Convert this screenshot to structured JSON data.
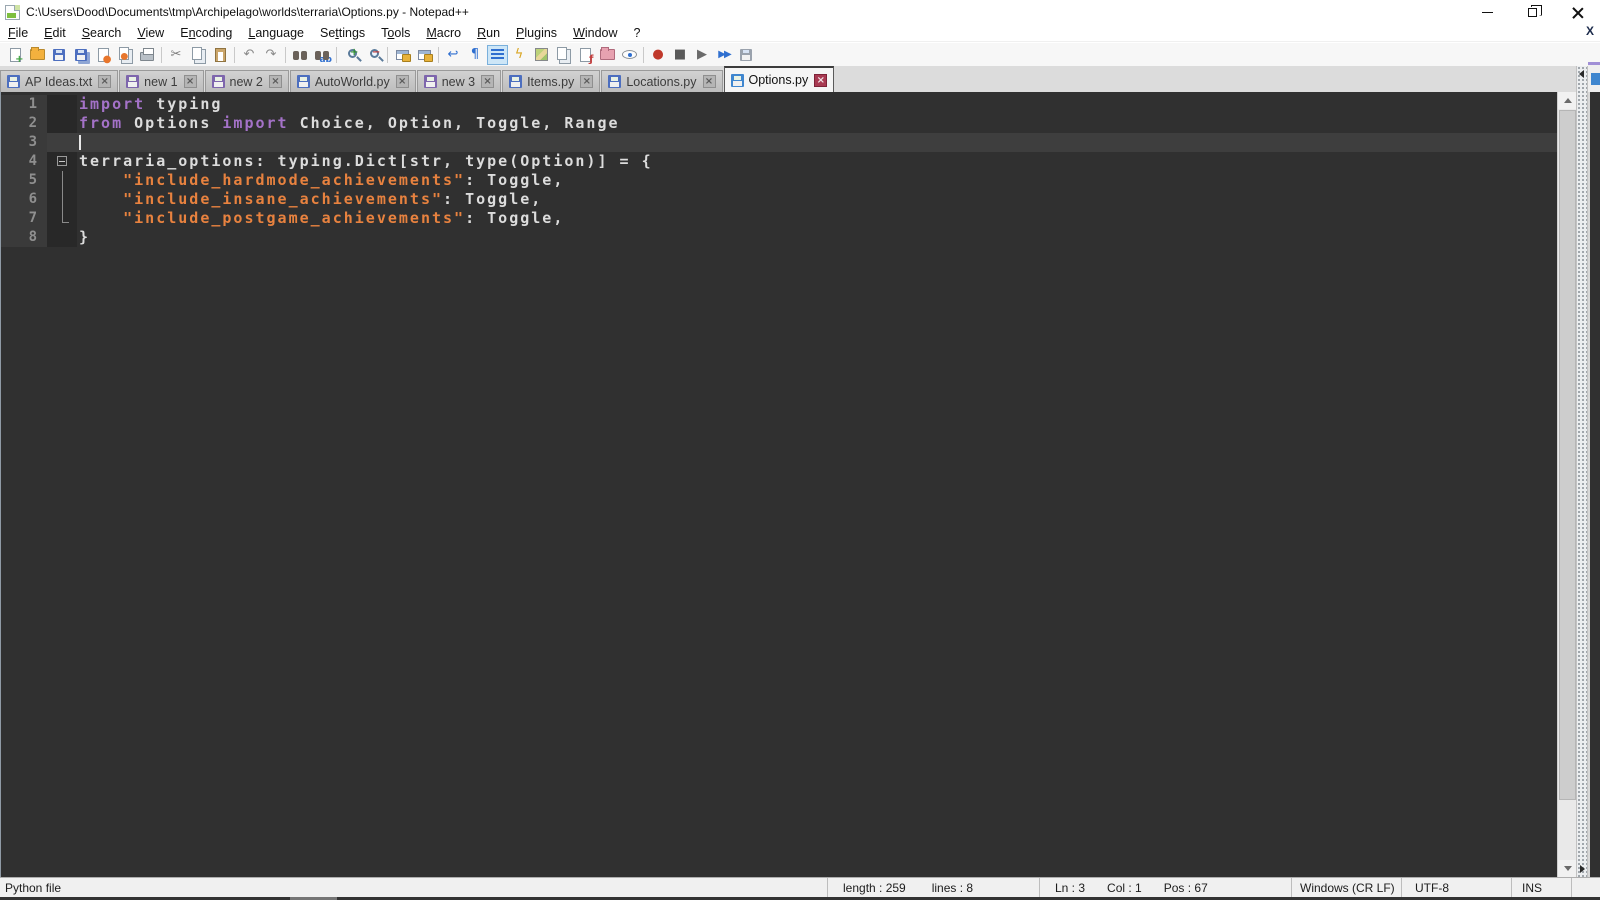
{
  "window": {
    "title": "C:\\Users\\Dood\\Documents\\tmp\\Archipelago\\worlds\\terraria\\Options.py - Notepad++",
    "menu_close_x": "X"
  },
  "menu": {
    "items": [
      {
        "label": "File",
        "u": 0
      },
      {
        "label": "Edit",
        "u": 0
      },
      {
        "label": "Search",
        "u": 0
      },
      {
        "label": "View",
        "u": 0
      },
      {
        "label": "Encoding",
        "u": 1
      },
      {
        "label": "Language",
        "u": 0
      },
      {
        "label": "Settings",
        "u": 2
      },
      {
        "label": "Tools",
        "u": 1
      },
      {
        "label": "Macro",
        "u": 0
      },
      {
        "label": "Run",
        "u": 0
      },
      {
        "label": "Plugins",
        "u": 0
      },
      {
        "label": "Window",
        "u": 0
      },
      {
        "label": "?",
        "u": -1
      }
    ]
  },
  "toolbar": {
    "items": [
      {
        "name": "new-file",
        "shape": "sh-page",
        "ov": "+",
        "ovColor": "#3fa33f"
      },
      {
        "name": "open-file",
        "shape": "sh-folder"
      },
      {
        "name": "save-file",
        "shape": "sh-floppy"
      },
      {
        "name": "save-all",
        "shape": "sh-floppy double"
      },
      {
        "name": "close-file",
        "shape": "sh-page",
        "ov": "●",
        "ovColor": "#e8762c"
      },
      {
        "name": "close-all",
        "shape": "sh-pages",
        "ov": "●",
        "ovColor": "#e8762c"
      },
      {
        "name": "print",
        "shape": "sh-printer"
      },
      {
        "sep": true
      },
      {
        "name": "cut",
        "glyph": "✂",
        "color": "#7a7a7a"
      },
      {
        "name": "copy",
        "shape": "sh-pages"
      },
      {
        "name": "paste",
        "shape": "sh-clip"
      },
      {
        "sep": true
      },
      {
        "name": "undo",
        "glyph": "↶",
        "color": "#8a8a8a"
      },
      {
        "name": "redo",
        "glyph": "↷",
        "color": "#8a8a8a"
      },
      {
        "sep": true
      },
      {
        "name": "find",
        "shape": "sh-binoc"
      },
      {
        "name": "replace",
        "shape": "sh-binoc",
        "ov": "ab"
      },
      {
        "sep": true
      },
      {
        "name": "zoom-in",
        "shape": "sh-lens",
        "ov": "+",
        "ovColor": "#2f8f2f"
      },
      {
        "name": "zoom-out",
        "shape": "sh-lens",
        "ov": "−",
        "ovColor": "#c23a3a"
      },
      {
        "sep": true
      },
      {
        "name": "sync-vertical-scrolling",
        "shape": "sh-winlock"
      },
      {
        "name": "sync-horizontal-scrolling",
        "shape": "sh-winlock"
      },
      {
        "sep": true
      },
      {
        "name": "word-wrap",
        "glyph": "↩",
        "color": "#2f6fd0"
      },
      {
        "name": "show-all-characters",
        "glyph": "¶",
        "color": "#2f6fd0"
      },
      {
        "name": "show-indent-guide",
        "shape": "sh-lines",
        "active": true
      },
      {
        "name": "function-list",
        "glyph": "ϟ",
        "color": "#d9a placeholder"
      },
      {
        "name": "document-map",
        "shape": "sh-map"
      },
      {
        "name": "document-switcher",
        "shape": "sh-pages"
      },
      {
        "name": "view-current-file",
        "shape": "sh-page",
        "ov": "ƒ",
        "ovColor": "#c23a3a"
      },
      {
        "name": "folder-as-workspace",
        "shape": "sh-folder pink"
      },
      {
        "name": "monitoring",
        "shape": "sh-eye"
      },
      {
        "sep": true
      },
      {
        "name": "macro-record",
        "glyph": "●",
        "color": "#c0392b"
      },
      {
        "name": "macro-stop",
        "glyph": "■",
        "color": "#5a5a5a"
      },
      {
        "name": "macro-play",
        "glyph": "▶",
        "color": "#6a6a6a"
      },
      {
        "name": "macro-run-multiple",
        "glyph": "▶▶",
        "color": "#2f6fd0",
        "small": true
      },
      {
        "name": "save-recorded-macro",
        "shape": "sh-floppy gray"
      }
    ]
  },
  "tabs": [
    {
      "label": "AP Ideas.txt",
      "state": "saved"
    },
    {
      "label": "new 1",
      "state": "modified"
    },
    {
      "label": "new 2",
      "state": "modified"
    },
    {
      "label": "AutoWorld.py",
      "state": "saved"
    },
    {
      "label": "new 3",
      "state": "modified"
    },
    {
      "label": "Items.py",
      "state": "saved"
    },
    {
      "label": "Locations.py",
      "state": "saved"
    },
    {
      "label": "Options.py",
      "state": "active"
    }
  ],
  "editor": {
    "colors": {
      "kw": "#a472c8",
      "df": "#dcdcdc",
      "st": "#e8823f"
    },
    "cursor_line": 3,
    "lines": [
      {
        "num": 1,
        "fold": null,
        "segments": [
          {
            "t": "import",
            "c": "kw"
          },
          {
            "t": " typing",
            "c": "df"
          }
        ]
      },
      {
        "num": 2,
        "fold": null,
        "segments": [
          {
            "t": "from",
            "c": "kw"
          },
          {
            "t": " Options ",
            "c": "df"
          },
          {
            "t": "import",
            "c": "kw"
          },
          {
            "t": " Choice, Option, Toggle, Range",
            "c": "df"
          }
        ]
      },
      {
        "num": 3,
        "fold": null,
        "current": true,
        "cursor": true,
        "segments": []
      },
      {
        "num": 4,
        "fold": "box",
        "segments": [
          {
            "t": "terraria_options: typing.Dict[str, type(Option)] = {",
            "c": "df"
          }
        ]
      },
      {
        "num": 5,
        "fold": "line",
        "segments": [
          {
            "t": "    ",
            "c": "df"
          },
          {
            "t": "\"include_hardmode_achievements\"",
            "c": "st"
          },
          {
            "t": ": Toggle,",
            "c": "df"
          }
        ]
      },
      {
        "num": 6,
        "fold": "line",
        "segments": [
          {
            "t": "    ",
            "c": "df"
          },
          {
            "t": "\"include_insane_achievements\"",
            "c": "st"
          },
          {
            "t": ": Toggle,",
            "c": "df"
          }
        ]
      },
      {
        "num": 7,
        "fold": "corner",
        "segments": [
          {
            "t": "    ",
            "c": "df"
          },
          {
            "t": "\"include_postgame_achievements\"",
            "c": "st"
          },
          {
            "t": ": Toggle,",
            "c": "df"
          }
        ]
      },
      {
        "num": 8,
        "fold": null,
        "segments": [
          {
            "t": "}",
            "c": "df"
          }
        ]
      }
    ]
  },
  "status_bar": {
    "doc_type": "Python file",
    "length_label": "length : 259",
    "lines_label": "lines : 8",
    "ln_label": "Ln : 3",
    "col_label": "Col : 1",
    "pos_label": "Pos : 67",
    "eol": "Windows (CR LF)",
    "encoding": "UTF-8",
    "mode": "INS"
  }
}
